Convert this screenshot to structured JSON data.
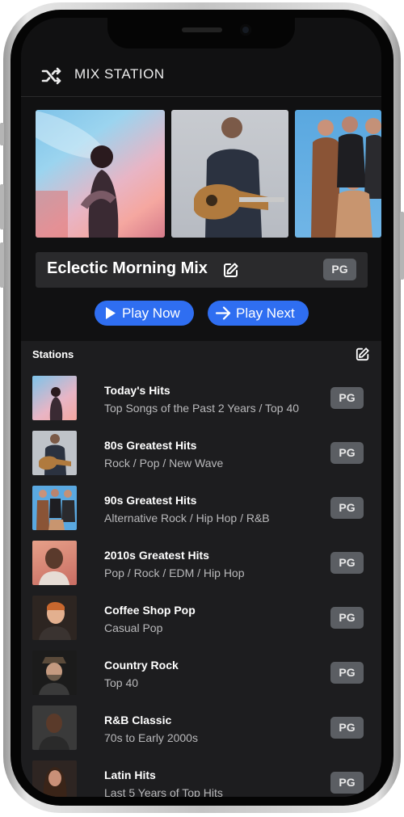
{
  "app": {
    "title": "MIX STATION"
  },
  "mix": {
    "title": "Eclectic Morning Mix",
    "rating": "PG",
    "play_now_label": "Play Now",
    "play_next_label": "Play Next"
  },
  "stations": {
    "heading": "Stations",
    "items": [
      {
        "name": "Today's Hits",
        "subtitle": "Top Songs of the Past 2 Years / Top 40",
        "rating": "PG"
      },
      {
        "name": "80s Greatest Hits",
        "subtitle": "Rock / Pop / New Wave",
        "rating": "PG"
      },
      {
        "name": "90s Greatest Hits",
        "subtitle": "Alternative Rock / Hip Hop / R&B",
        "rating": "PG"
      },
      {
        "name": "2010s Greatest Hits",
        "subtitle": "Pop / Rock / EDM / Hip Hop",
        "rating": "PG"
      },
      {
        "name": "Coffee Shop Pop",
        "subtitle": "Casual Pop",
        "rating": "PG"
      },
      {
        "name": "Country Rock",
        "subtitle": "Top 40",
        "rating": "PG"
      },
      {
        "name": "R&B Classic",
        "subtitle": "70s to Early 2000s",
        "rating": "PG"
      },
      {
        "name": "Latin Hits",
        "subtitle": "Last 5 Years of Top Hits",
        "rating": "PG"
      }
    ]
  },
  "colors": {
    "accent": "#2f6ef1",
    "background": "#111112",
    "panel": "#1d1d1f",
    "badge": "#5b5e63"
  },
  "icons": {
    "header": "shuffle-icon",
    "mix_edit": "edit-icon",
    "stations_edit": "edit-icon",
    "play": "play-icon",
    "next": "arrow-right-icon"
  }
}
